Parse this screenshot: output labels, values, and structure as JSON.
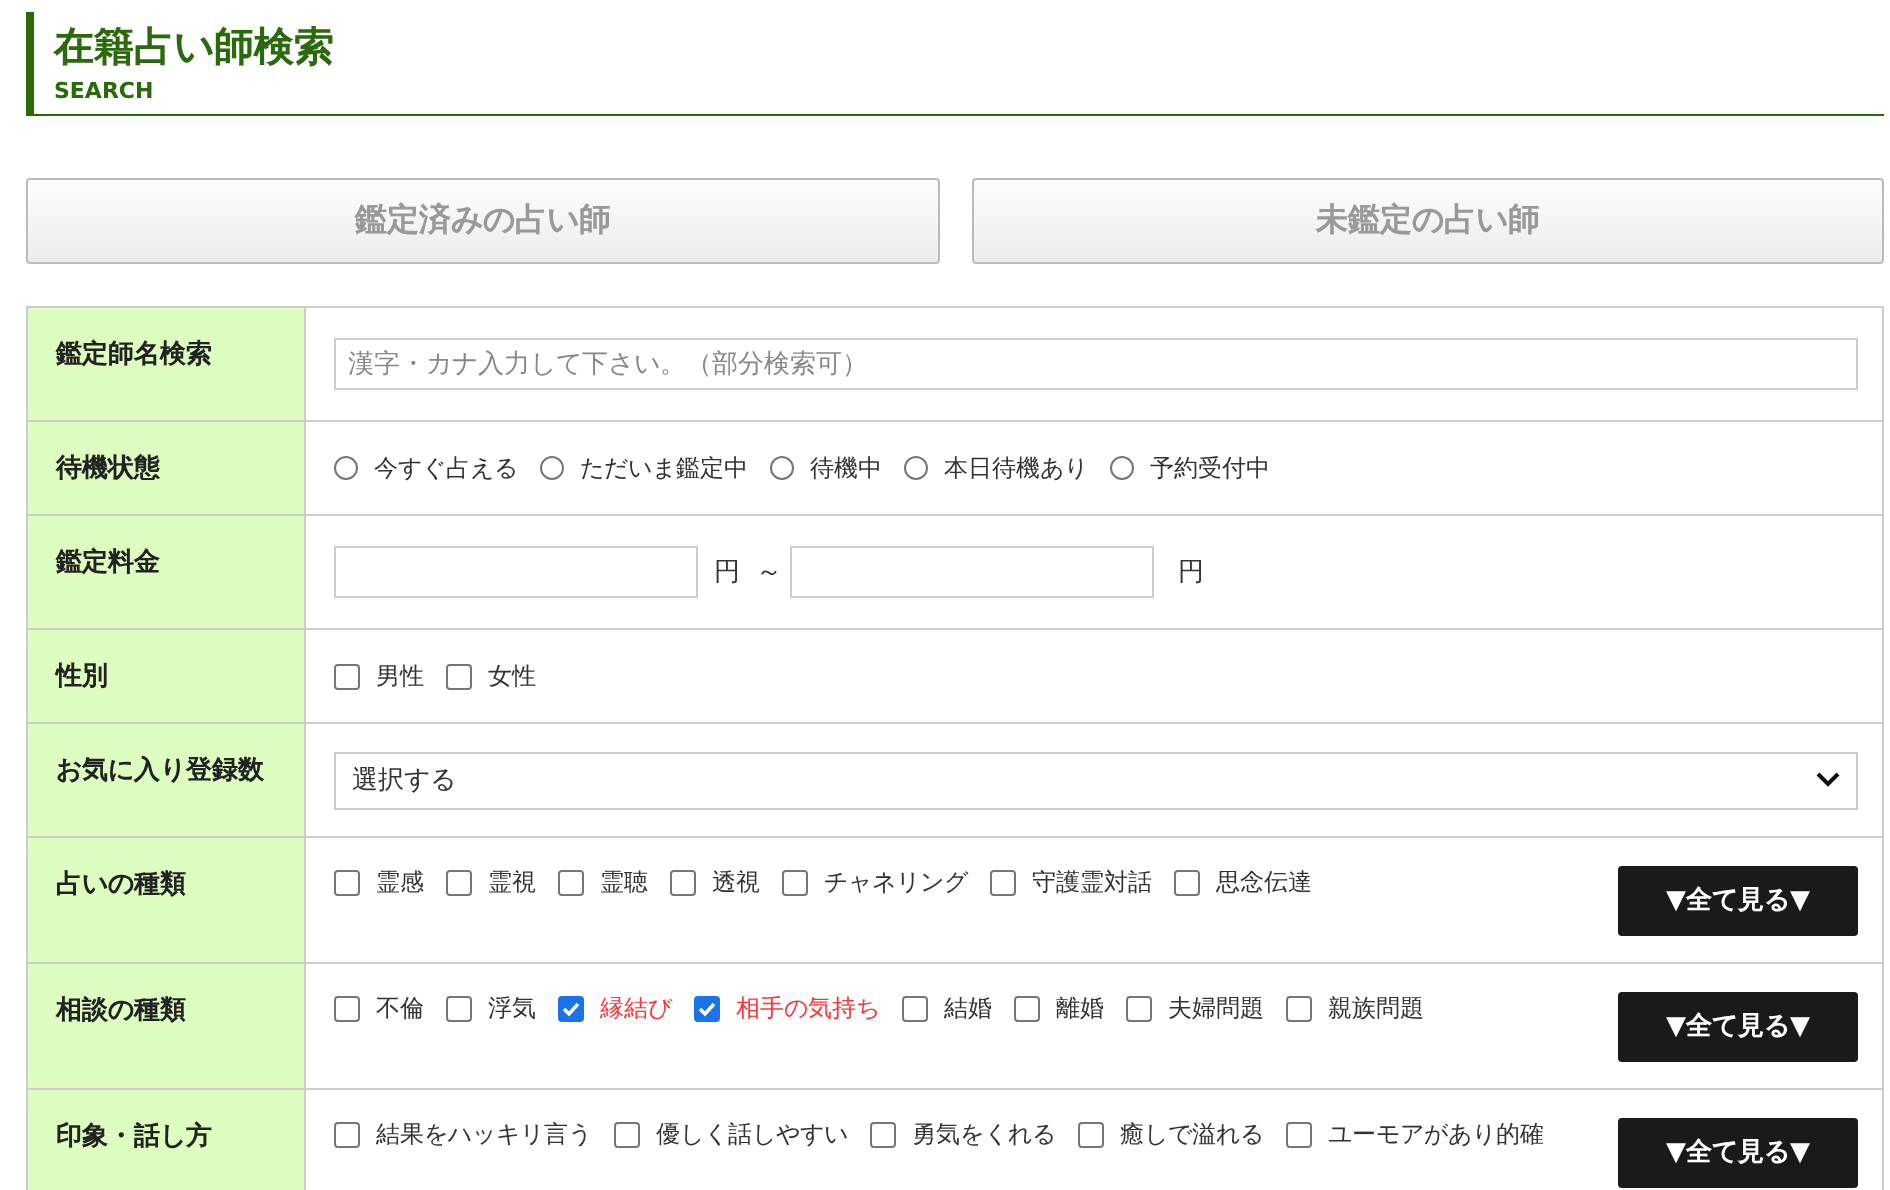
{
  "header": {
    "title": "在籍占い師検索",
    "subtitle": "SEARCH"
  },
  "tabs": [
    {
      "label": "鑑定済みの占い師",
      "selected": false
    },
    {
      "label": "未鑑定の占い師",
      "selected": false
    }
  ],
  "rows": [
    {
      "kind": "text",
      "label": "鑑定師名検索",
      "placeholder": "漢字・カナ入力して下さい。（部分検索可）"
    },
    {
      "kind": "radio",
      "label": "待機状態",
      "options": [
        {
          "label": "今すぐ占える",
          "selected": false
        },
        {
          "label": "ただいま鑑定中",
          "selected": false
        },
        {
          "label": "待機中",
          "selected": false
        },
        {
          "label": "本日待機あり",
          "selected": false
        },
        {
          "label": "予約受付中",
          "selected": false
        }
      ]
    },
    {
      "kind": "range",
      "label": "鑑定料金",
      "unit_from": "円",
      "separator": "～",
      "unit_to": "円"
    },
    {
      "kind": "checks",
      "label": "性別",
      "options": [
        {
          "label": "男性",
          "checked": false
        },
        {
          "label": "女性",
          "checked": false
        }
      ]
    },
    {
      "kind": "select",
      "label": "お気に入り登録数",
      "value": "選択する"
    },
    {
      "kind": "checks",
      "label": "占いの種類",
      "button": "▼全て見る▼",
      "options": [
        {
          "label": "霊感",
          "checked": false
        },
        {
          "label": "霊視",
          "checked": false
        },
        {
          "label": "霊聴",
          "checked": false
        },
        {
          "label": "透視",
          "checked": false
        },
        {
          "label": "チャネリング",
          "checked": false
        },
        {
          "label": "守護霊対話",
          "checked": false
        },
        {
          "label": "思念伝達",
          "checked": false
        }
      ]
    },
    {
      "kind": "checks",
      "label": "相談の種類",
      "button": "▼全て見る▼",
      "options": [
        {
          "label": "不倫",
          "checked": false
        },
        {
          "label": "浮気",
          "checked": false
        },
        {
          "label": "縁結び",
          "checked": true
        },
        {
          "label": "相手の気持ち",
          "checked": true
        },
        {
          "label": "結婚",
          "checked": false
        },
        {
          "label": "離婚",
          "checked": false
        },
        {
          "label": "夫婦問題",
          "checked": false
        },
        {
          "label": "親族問題",
          "checked": false
        }
      ]
    },
    {
      "kind": "checks",
      "label": "印象・話し方",
      "button": "▼全て見る▼",
      "options": [
        {
          "label": "結果をハッキリ言う",
          "checked": false
        },
        {
          "label": "優しく話しやすい",
          "checked": false
        },
        {
          "label": "勇気をくれる",
          "checked": false
        },
        {
          "label": "癒しで溢れる",
          "checked": false
        },
        {
          "label": "ユーモアがあり的確",
          "checked": false
        }
      ]
    }
  ]
}
